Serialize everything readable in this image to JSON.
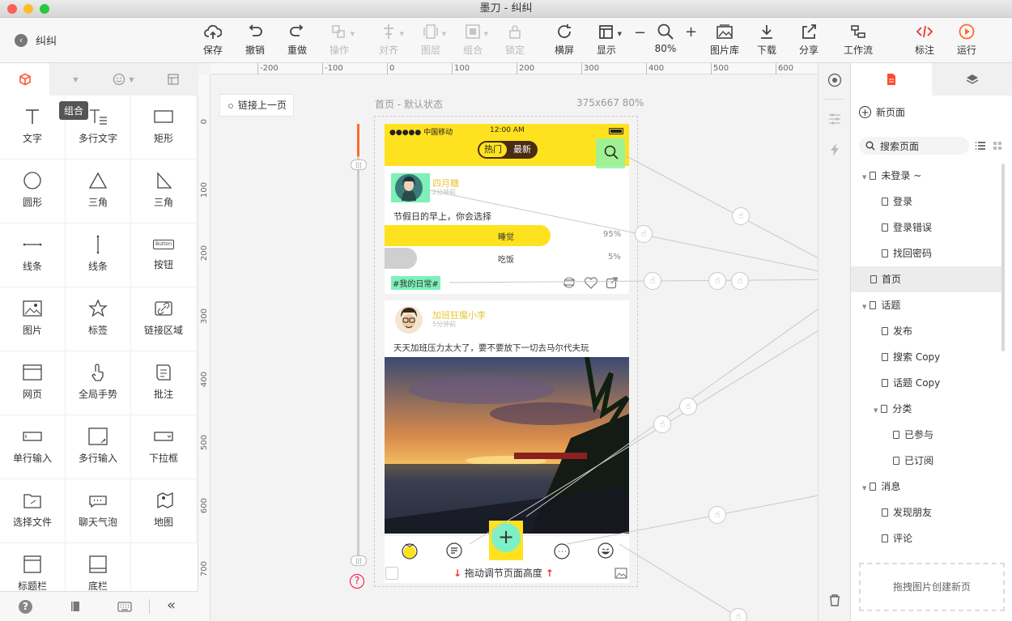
{
  "app": {
    "title": "墨刀 - 纠纠",
    "back_label": "纠纠"
  },
  "toolbar": [
    {
      "label": "保存",
      "icon": "upload-cloud-icon",
      "enabled": true
    },
    {
      "label": "撤销",
      "icon": "undo-icon",
      "enabled": true
    },
    {
      "label": "重做",
      "icon": "redo-icon",
      "enabled": true
    },
    {
      "label": "操作",
      "icon": "operate-icon",
      "enabled": false
    },
    {
      "label": "对齐",
      "icon": "align-icon",
      "enabled": false
    },
    {
      "label": "图层",
      "icon": "layer-icon",
      "enabled": false
    },
    {
      "label": "组合",
      "icon": "group-icon",
      "enabled": false
    },
    {
      "label": "锁定",
      "icon": "lock-icon",
      "enabled": false
    },
    {
      "label": "横屏",
      "icon": "rotate-icon",
      "enabled": true
    },
    {
      "label": "显示",
      "icon": "display-icon",
      "enabled": true
    },
    {
      "label": "80%",
      "icon": "zoom-icon",
      "enabled": true
    },
    {
      "label": "图片库",
      "icon": "image-library-icon",
      "enabled": true
    },
    {
      "label": "下载",
      "icon": "download-icon",
      "enabled": true
    },
    {
      "label": "分享",
      "icon": "share-icon",
      "enabled": true
    },
    {
      "label": "工作流",
      "icon": "workflow-icon",
      "enabled": true
    },
    {
      "label": "标注",
      "icon": "code-icon",
      "enabled": true
    },
    {
      "label": "运行",
      "icon": "play-icon",
      "enabled": true
    }
  ],
  "zoom": {
    "minus": "−",
    "plus": "+"
  },
  "left_tabs": {
    "tooltip": "组合"
  },
  "tools": [
    "文字",
    "多行文字",
    "矩形",
    "圆形",
    "三角",
    "三角",
    "线条",
    "线条",
    "按钮",
    "图片",
    "标签",
    "链接区域",
    "网页",
    "全局手势",
    "批注",
    "单行输入",
    "多行输入",
    "下拉框",
    "选择文件",
    "聊天气泡",
    "地图",
    "标题栏",
    "底栏"
  ],
  "button_widget_text": "Button",
  "ruler": {
    "top": [
      "-200",
      "-100",
      "0",
      "100",
      "200",
      "300",
      "400",
      "500",
      "600"
    ],
    "left": [
      "0",
      "100",
      "200",
      "300",
      "400",
      "500",
      "600",
      "700"
    ]
  },
  "canvas": {
    "link_prev": "链接上一页",
    "page_label": "首页 - 默认状态",
    "page_size": "375x667 80%",
    "drag_hint": "拖动调节页面高度"
  },
  "phone": {
    "status": {
      "carrier": "●●●●● 中国移动",
      "time": "12:00 AM"
    },
    "tabs": [
      "热门",
      "最新"
    ],
    "post1": {
      "user": "四月糖",
      "time": "2分钟前",
      "text": "节假日的早上，你会选择",
      "options": [
        {
          "label": "睡觉",
          "pct": "95%",
          "value": 95
        },
        {
          "label": "吃饭",
          "pct": "5%",
          "value": 5
        }
      ],
      "tag": "#我的日常#"
    },
    "post2": {
      "user": "加班狂魔小李",
      "time": "5分钟前",
      "text": "天天加班压力太大了，要不要放下一切去马尔代夫玩"
    }
  },
  "right": {
    "new_page": "新页面",
    "search_placeholder": "搜索页面",
    "drop_hint": "拖拽图片创建新页",
    "pages": [
      {
        "label": "未登录 ~",
        "level": 0,
        "folder": true
      },
      {
        "label": "登录",
        "level": 1
      },
      {
        "label": "登录错误",
        "level": 1
      },
      {
        "label": "找回密码",
        "level": 1
      },
      {
        "label": "首页",
        "level": 0,
        "selected": true
      },
      {
        "label": "话题",
        "level": 0,
        "folder": true
      },
      {
        "label": "发布",
        "level": 1
      },
      {
        "label": "搜索 Copy",
        "level": 1
      },
      {
        "label": "话题 Copy",
        "level": 1
      },
      {
        "label": "分类",
        "level": 1,
        "folder": true
      },
      {
        "label": "已参与",
        "level": 2
      },
      {
        "label": "已订阅",
        "level": 2
      },
      {
        "label": "消息",
        "level": 0,
        "folder": true
      },
      {
        "label": "发现朋友",
        "level": 1
      },
      {
        "label": "评论",
        "level": 1
      }
    ]
  },
  "colors": {
    "accent": "#ff5b2e",
    "yellow": "#ffe21f",
    "link_green": "#7ef0b8"
  }
}
